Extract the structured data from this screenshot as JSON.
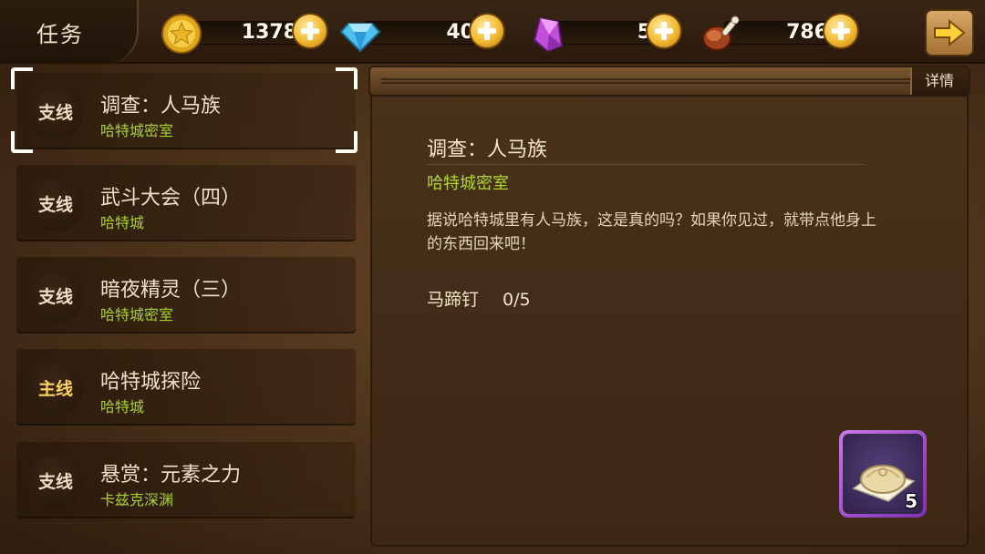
{
  "header": {
    "title": "任务",
    "resources": [
      {
        "name": "gold",
        "value": "1378",
        "icon": "gold-coin-icon"
      },
      {
        "name": "diamond",
        "value": "40",
        "icon": "blue-diamond-icon"
      },
      {
        "name": "crystal",
        "value": "5",
        "icon": "purple-crystal-icon"
      },
      {
        "name": "meat",
        "value": "786",
        "icon": "meat-drumstick-icon"
      }
    ],
    "exit_icon": "arrow-right-icon"
  },
  "quests": [
    {
      "type": "支线",
      "name": "调查：人马族",
      "location": "哈特城密室",
      "selected": true
    },
    {
      "type": "支线",
      "name": "武斗大会（四）",
      "location": "哈特城"
    },
    {
      "type": "支线",
      "name": "暗夜精灵（三）",
      "location": "哈特城密室"
    },
    {
      "type": "主线",
      "name": "哈特城探险",
      "location": "哈特城"
    },
    {
      "type": "支线",
      "name": "悬赏：元素之力",
      "location": "卡兹克深渊"
    }
  ],
  "detail": {
    "tab_label": "详情",
    "title": "调查：人马族",
    "location": "哈特城密室",
    "description": "据说哈特城里有人马族，这是真的吗？如果你见过，就带点他身上的东西回来吧！",
    "goal_item": "马蹄钉",
    "goal_progress": "0/5",
    "reward": {
      "icon": "horseshoe-nail-bundle-icon",
      "count": "5"
    }
  },
  "colors": {
    "accent_green": "#a9d12e",
    "main_quest_gold": "#ffd35c",
    "reward_frame": "#a24fd8"
  }
}
